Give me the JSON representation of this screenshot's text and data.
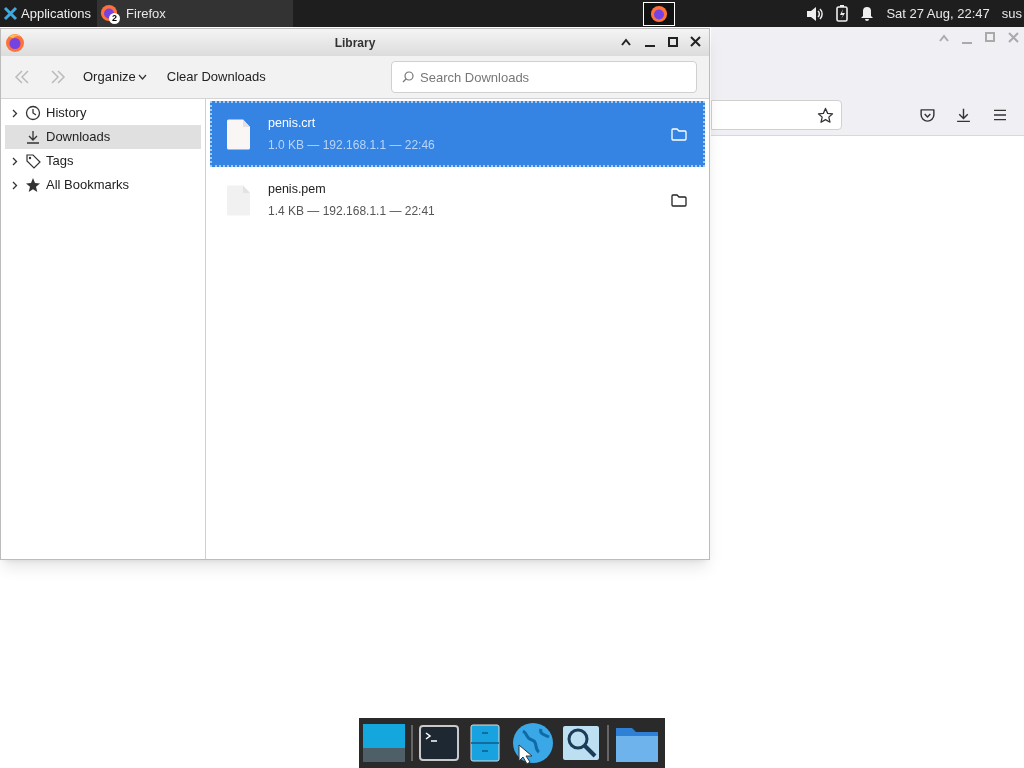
{
  "top_panel": {
    "applications": "Applications",
    "task": "Firefox",
    "task_badge": "2",
    "clock": "Sat 27 Aug, 22:47",
    "user": "sus"
  },
  "library": {
    "title": "Library",
    "toolbar": {
      "organize": "Organize",
      "clear": "Clear Downloads",
      "search_placeholder": "Search Downloads"
    },
    "sidebar": [
      {
        "label": "History",
        "kind": "history",
        "expandable": true,
        "selected": false
      },
      {
        "label": "Downloads",
        "kind": "downloads",
        "expandable": false,
        "selected": true
      },
      {
        "label": "Tags",
        "kind": "tags",
        "expandable": true,
        "selected": false
      },
      {
        "label": "All Bookmarks",
        "kind": "bookmarks",
        "expandable": true,
        "selected": false
      }
    ],
    "downloads": [
      {
        "name": "penis.crt",
        "details": "1.0 KB — 192.168.1.1 — 22:46",
        "selected": true
      },
      {
        "name": "penis.pem",
        "details": "1.4 KB — 192.168.1.1 — 22:41",
        "selected": false
      }
    ]
  }
}
